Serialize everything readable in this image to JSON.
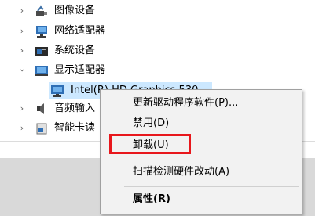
{
  "tree": {
    "items": [
      {
        "label": "图像设备",
        "icon": "camera-icon",
        "state": "collapsed"
      },
      {
        "label": "网络适配器",
        "icon": "network-adapter-icon",
        "state": "collapsed"
      },
      {
        "label": "系统设备",
        "icon": "system-device-icon",
        "state": "collapsed"
      },
      {
        "label": "显示适配器",
        "icon": "display-adapter-icon",
        "state": "expanded"
      },
      {
        "label": "Intel(R) HD Graphics 530",
        "icon": "monitor-icon",
        "state": "selected"
      },
      {
        "label": "音频输入",
        "icon": "audio-icon",
        "state": "collapsed"
      },
      {
        "label": "智能卡读",
        "icon": "smart-card-icon",
        "state": "collapsed"
      }
    ]
  },
  "context_menu": {
    "items": [
      {
        "label": "更新驱动程序软件(P)..."
      },
      {
        "label": "禁用(D)"
      },
      {
        "label": "卸载(U)",
        "highlighted": true
      },
      {
        "label": "扫描检测硬件改动(A)"
      },
      {
        "label": "属性(R)",
        "bold": true
      }
    ]
  },
  "colors": {
    "selection": "#cce8ff",
    "highlight_border": "#e8171c",
    "menu_background": "#f2f2f2"
  }
}
